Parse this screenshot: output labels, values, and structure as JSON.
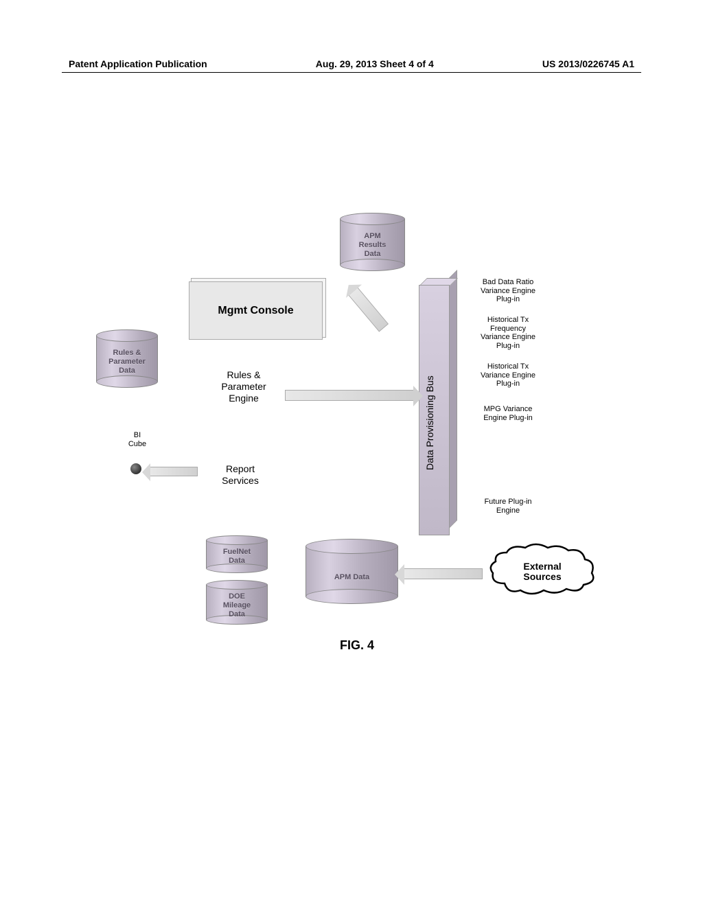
{
  "header": {
    "left": "Patent Application Publication",
    "center": "Aug. 29, 2013  Sheet 4 of 4",
    "right": "US 2013/0226745 A1"
  },
  "components": {
    "apm_results": "APM\nResults\nData",
    "rules_param_data": "Rules &\nParameter\nData",
    "mgmt_console": "Mgmt Console",
    "rules_engine": "Rules &\nParameter\nEngine",
    "bi_cube": "BI\nCube",
    "report_services": "Report\nServices",
    "fuelnet": "FuelNet\nData",
    "doe": "DOE\nMileage\nData",
    "apm_data": "APM Data",
    "bus": "Data Provisioning Bus",
    "external": "External\nSources"
  },
  "plugins": {
    "p1": "Bad Data Ratio\nVariance Engine\nPlug-in",
    "p2": "Historical Tx\nFrequency\nVariance Engine\nPlug-in",
    "p3": "Historical Tx\nVariance Engine\nPlug-in",
    "p4": "MPG Variance\nEngine Plug-in",
    "p5": "Future Plug-in\nEngine"
  },
  "figure_label": "FIG. 4",
  "chart_data": {
    "type": "diagram",
    "title": "FIG. 4",
    "nodes": [
      {
        "id": "apm_results",
        "label": "APM Results Data",
        "shape": "cylinder"
      },
      {
        "id": "mgmt_console",
        "label": "Mgmt Console",
        "shape": "box3d"
      },
      {
        "id": "rules_param_data",
        "label": "Rules & Parameter Data",
        "shape": "cylinder"
      },
      {
        "id": "rules_engine",
        "label": "Rules & Parameter Engine",
        "shape": "text"
      },
      {
        "id": "bi_cube",
        "label": "BI Cube",
        "shape": "sphere"
      },
      {
        "id": "report_services",
        "label": "Report Services",
        "shape": "text"
      },
      {
        "id": "fuelnet",
        "label": "FuelNet Data",
        "shape": "cylinder"
      },
      {
        "id": "doe",
        "label": "DOE Mileage Data",
        "shape": "cylinder"
      },
      {
        "id": "apm_data",
        "label": "APM Data",
        "shape": "cylinder"
      },
      {
        "id": "bus",
        "label": "Data Provisioning Bus",
        "shape": "bar3d_vertical"
      },
      {
        "id": "external",
        "label": "External Sources",
        "shape": "cloud"
      },
      {
        "id": "plugin_bad_data",
        "label": "Bad Data Ratio Variance Engine Plug-in",
        "shape": "text"
      },
      {
        "id": "plugin_hist_freq",
        "label": "Historical Tx Frequency Variance Engine Plug-in",
        "shape": "text"
      },
      {
        "id": "plugin_hist_tx",
        "label": "Historical Tx Variance Engine Plug-in",
        "shape": "text"
      },
      {
        "id": "plugin_mpg",
        "label": "MPG Variance Engine Plug-in",
        "shape": "text"
      },
      {
        "id": "plugin_future",
        "label": "Future Plug-in Engine",
        "shape": "text"
      }
    ],
    "edges": [
      {
        "from": "rules_engine",
        "to": "bus",
        "style": "arrow3d"
      },
      {
        "from": "bus",
        "to": "apm_results",
        "style": "arrow3d"
      },
      {
        "from": "report_services",
        "to": "bi_cube",
        "style": "arrow3d"
      },
      {
        "from": "external",
        "to": "apm_data",
        "style": "arrow3d"
      }
    ]
  }
}
